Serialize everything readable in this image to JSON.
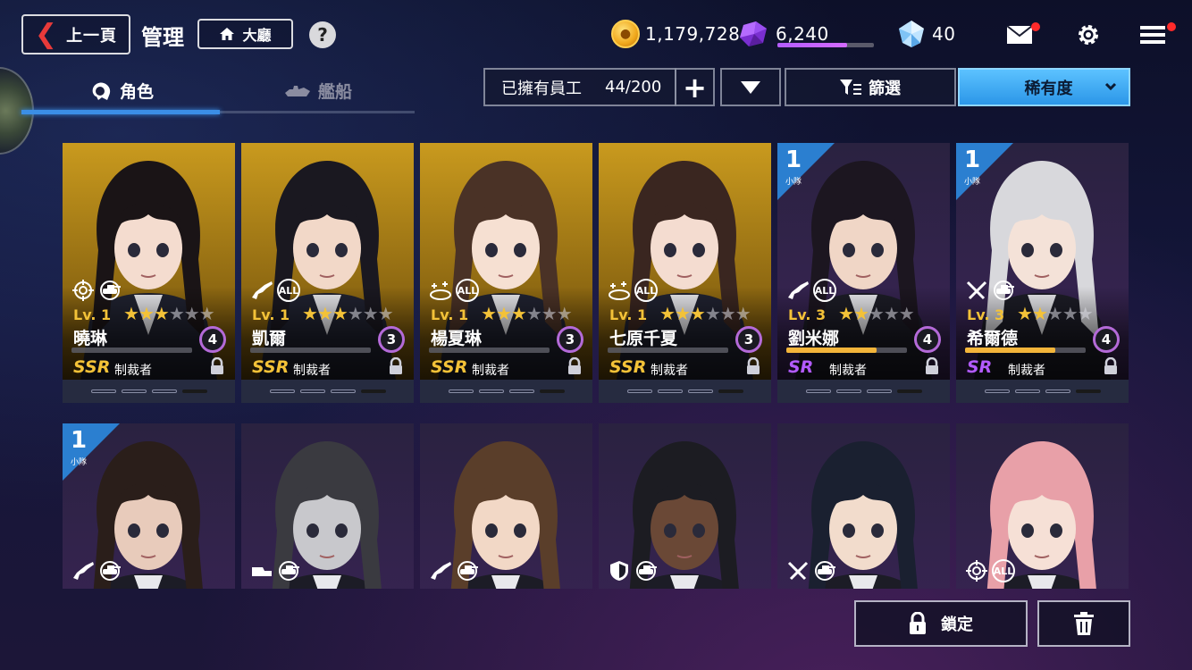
{
  "header": {
    "back_label": "上一頁",
    "title": "管理",
    "lobby_label": "大廳",
    "help_label": "?"
  },
  "currencies": {
    "gold": "1,179,728",
    "gems": "6,240",
    "gems_progress": 0.72,
    "diamonds": "40"
  },
  "icons": {
    "back": "chevron-left-icon",
    "lobby": "home-icon",
    "help": "question-icon",
    "gold": "gold-coin-icon",
    "gems": "purple-crystal-icon",
    "diamonds": "diamond-icon",
    "mail": "mail-icon",
    "settings": "gear-icon",
    "menu": "hamburger-menu-icon",
    "characters": "character-head-icon",
    "ships": "ship-icon",
    "filter": "filter-icon",
    "lock": "lock-icon",
    "delete": "trash-icon"
  },
  "colors": {
    "accent_blue": "#3b8ee6",
    "sort_button": "#2b96e8",
    "ssr": "#f3c238",
    "sr": "#b35bff",
    "notify": "#ff2a2a"
  },
  "tabs": [
    {
      "label": "角色",
      "active": true
    },
    {
      "label": "艦船",
      "active": false
    }
  ],
  "toolbar": {
    "owned_label": "已擁有員工",
    "owned_count": "44/200",
    "add_label": "+",
    "filter_label": "篩選",
    "sort_label": "稀有度"
  },
  "cards_row1": [
    {
      "name": "曉琳",
      "level": "Lv. 1",
      "stars": 3,
      "max_stars": 6,
      "rank": "4",
      "rarity": "SSR",
      "class": "制裁者",
      "progress": 0.0,
      "squad": "",
      "roles": [
        "target-icon",
        "tank-icon"
      ],
      "roles_text": "",
      "bg": "gold"
    },
    {
      "name": "凱爾",
      "level": "Lv. 1",
      "stars": 3,
      "max_stars": 6,
      "rank": "3",
      "rarity": "SSR",
      "class": "制裁者",
      "progress": 0.0,
      "squad": "",
      "roles": [
        "gun-icon"
      ],
      "roles_text": "ALL",
      "bg": "gold"
    },
    {
      "name": "楊夏琳",
      "level": "Lv. 1",
      "stars": 3,
      "max_stars": 6,
      "rank": "3",
      "rarity": "SSR",
      "class": "制裁者",
      "progress": 0.0,
      "squad": "",
      "roles": [
        "support-icon"
      ],
      "roles_text": "ALL",
      "bg": "gold"
    },
    {
      "name": "七原千夏",
      "level": "Lv. 1",
      "stars": 3,
      "max_stars": 6,
      "rank": "3",
      "rarity": "SSR",
      "class": "制裁者",
      "progress": 0.0,
      "squad": "",
      "roles": [
        "support-icon"
      ],
      "roles_text": "ALL",
      "bg": "gold"
    },
    {
      "name": "劉米娜",
      "level": "Lv. 3",
      "stars": 2,
      "max_stars": 5,
      "rank": "4",
      "rarity": "SR",
      "class": "制裁者",
      "progress": 0.75,
      "squad": "1",
      "roles": [
        "gun-icon"
      ],
      "roles_text": "ALL",
      "bg": "purple"
    },
    {
      "name": "希爾德",
      "level": "Lv. 3",
      "stars": 2,
      "max_stars": 5,
      "rank": "4",
      "rarity": "SR",
      "class": "制裁者",
      "progress": 0.75,
      "squad": "1",
      "roles": [
        "swords-icon",
        "tank-icon"
      ],
      "roles_text": "",
      "bg": "purple"
    }
  ],
  "cards_row2": [
    {
      "squad": "1",
      "roles": [
        "gun-icon",
        "tank-icon"
      ],
      "roles_text": "",
      "bg": "purple"
    },
    {
      "squad": "",
      "roles": [
        "vehicle-icon",
        "tank-icon"
      ],
      "roles_text": "",
      "bg": "purple"
    },
    {
      "squad": "",
      "roles": [
        "gun-icon",
        "tank-icon"
      ],
      "roles_text": "",
      "bg": "purple"
    },
    {
      "squad": "",
      "roles": [
        "shield-icon",
        "tank-icon"
      ],
      "roles_text": "",
      "bg": "purple"
    },
    {
      "squad": "",
      "roles": [
        "swords-icon",
        "tank-icon"
      ],
      "roles_text": "",
      "bg": "purple"
    },
    {
      "squad": "",
      "roles": [
        "target-icon"
      ],
      "roles_text": "ALL",
      "bg": "purple"
    }
  ],
  "squad_sub_label": "小隊",
  "bottom": {
    "lock_label": "鎖定"
  }
}
